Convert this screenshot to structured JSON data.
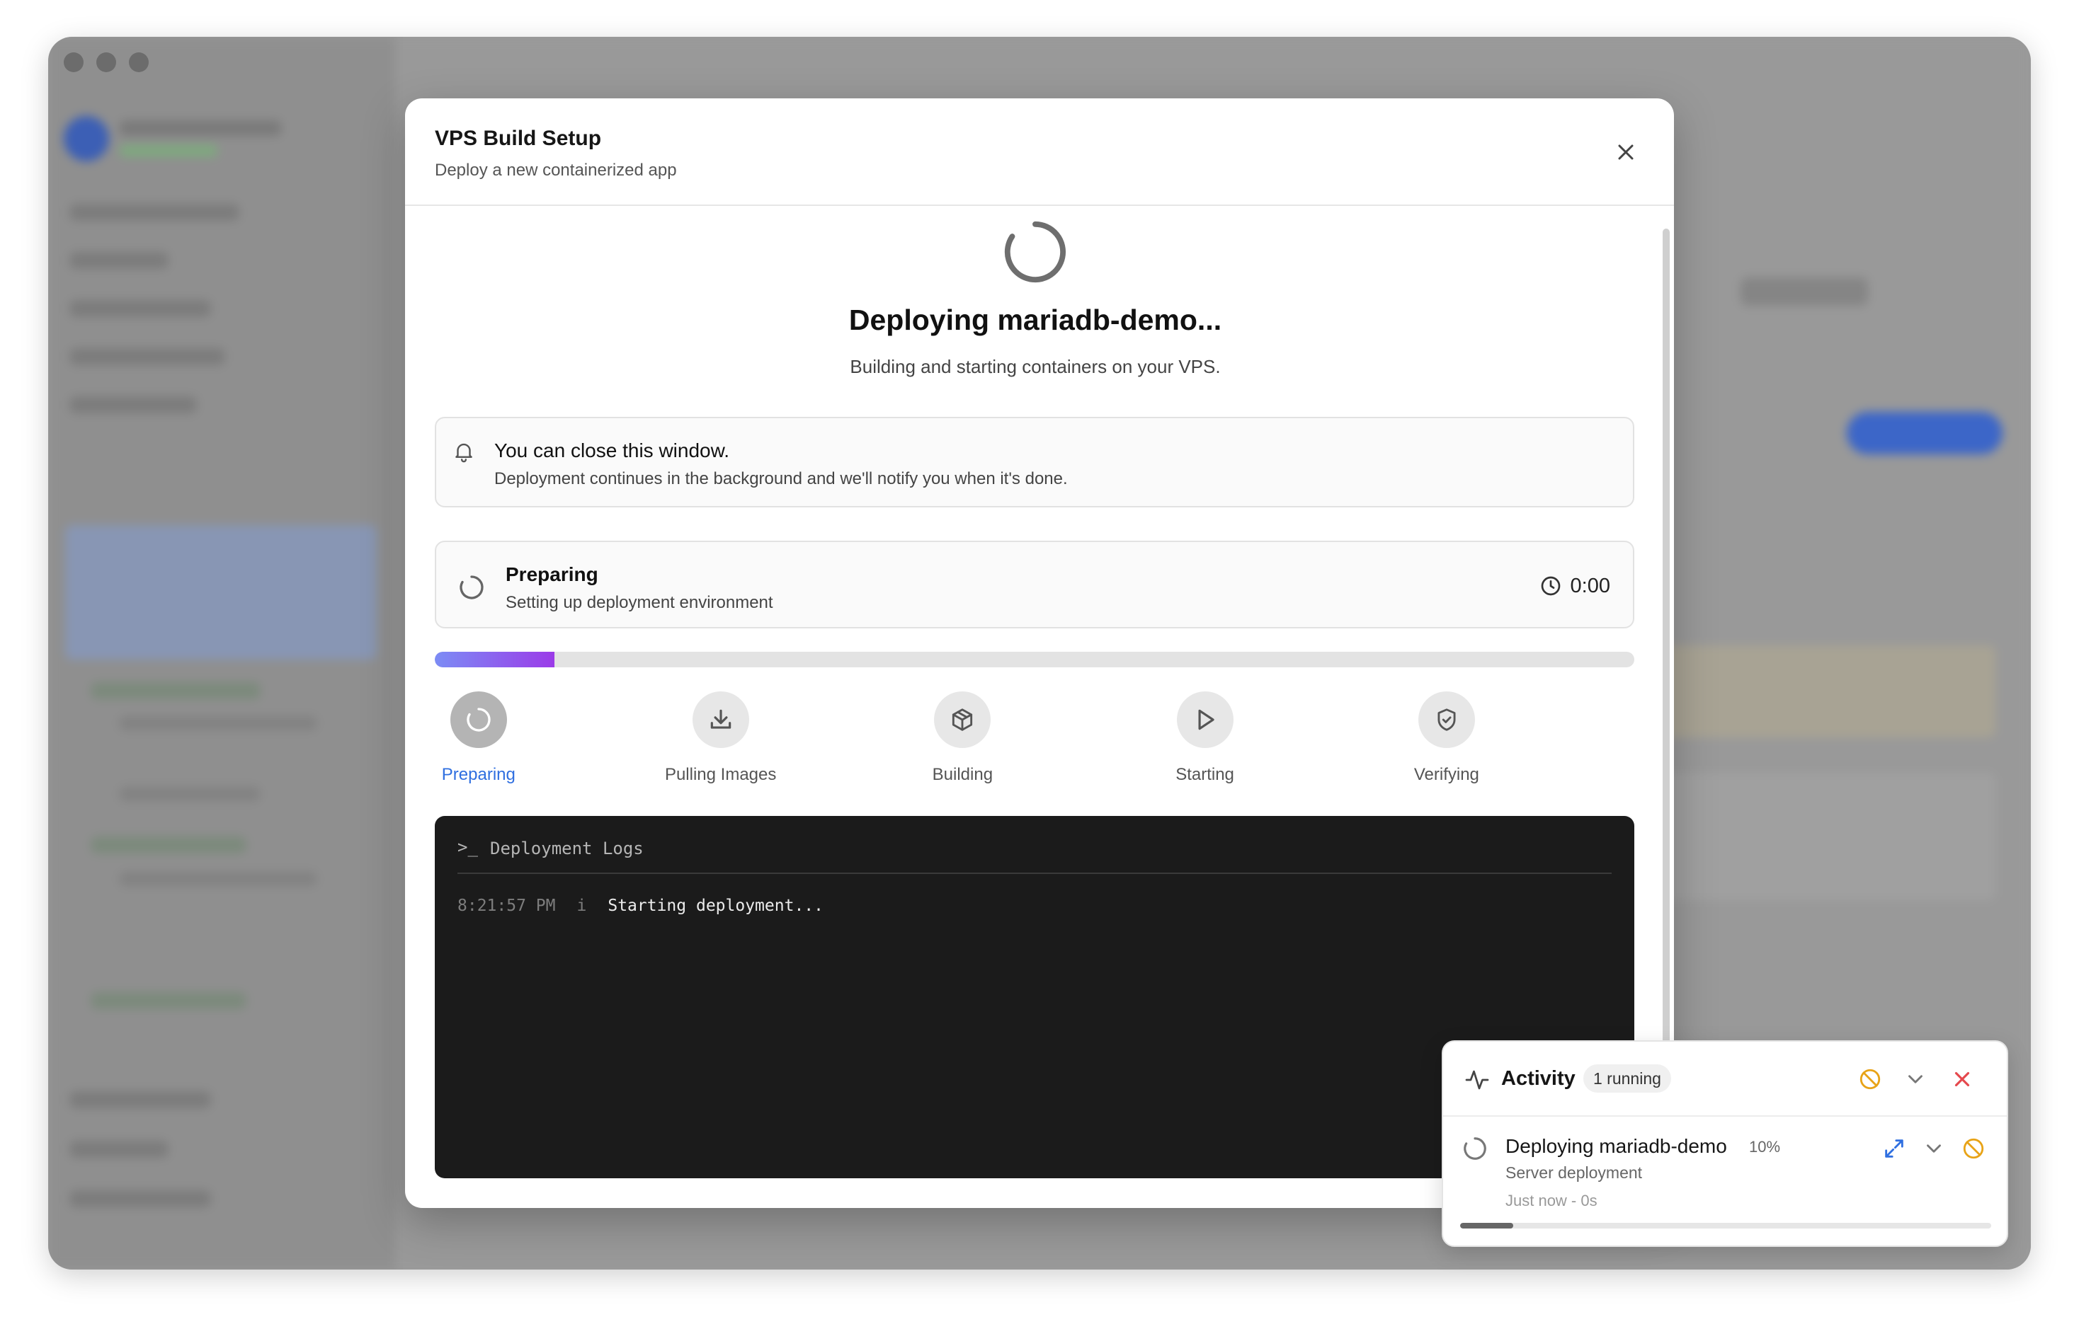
{
  "modal": {
    "title": "VPS Build Setup",
    "subtitle": "Deploy a new containerized app",
    "deploy_title": "Deploying mariadb-demo...",
    "deploy_subtitle": "Building and starting containers on your VPS."
  },
  "notice": {
    "title": "You can close this window.",
    "text": "Deployment continues in the background and we'll notify you when it's done.",
    "icon": "bell-icon"
  },
  "status": {
    "title": "Preparing",
    "text": "Setting up deployment environment",
    "time": "0:00"
  },
  "progress": {
    "value": 0.1,
    "gradient": [
      "#7c8cf5",
      "#9b3be8"
    ]
  },
  "steps": [
    {
      "label": "Preparing",
      "icon": "spinner-icon",
      "active": true
    },
    {
      "label": "Pulling Images",
      "icon": "download-icon",
      "active": false
    },
    {
      "label": "Building",
      "icon": "box-icon",
      "active": false
    },
    {
      "label": "Starting",
      "icon": "play-icon",
      "active": false
    },
    {
      "label": "Verifying",
      "icon": "shield-check-icon",
      "active": false
    }
  ],
  "logs": {
    "prompt": ">_",
    "title": "Deployment Logs",
    "entries": [
      {
        "time": "8:21:57 PM",
        "level": "i",
        "message": "Starting deployment..."
      }
    ]
  },
  "activity": {
    "title": "Activity",
    "badge": "1 running",
    "item": {
      "title": "Deploying mariadb-demo",
      "percent": "10%",
      "progress": 0.1,
      "subtitle": "Server deployment",
      "meta": "Just now  -  0s"
    }
  },
  "colors": {
    "accent": "#2f6fe0",
    "warning": "#e8a317",
    "danger": "#e5484d",
    "log_bg": "#1b1b1b"
  }
}
